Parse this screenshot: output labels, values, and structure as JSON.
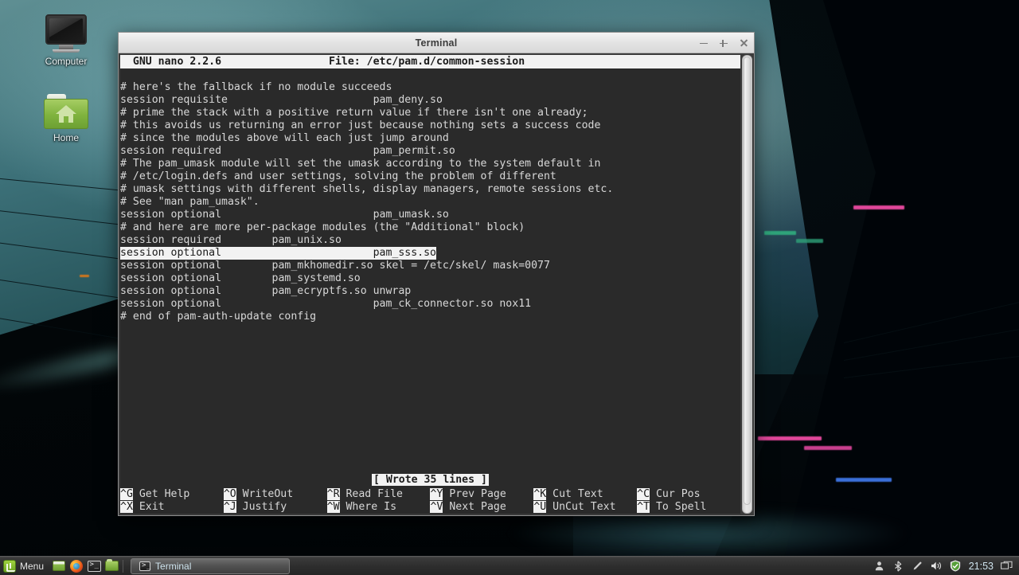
{
  "desktop": {
    "icons": [
      {
        "name": "computer",
        "label": "Computer"
      },
      {
        "name": "home",
        "label": "Home"
      }
    ],
    "wallpaper_colors": {
      "sky_light": "#5f8f93",
      "sky_mid": "#255258",
      "sky_dark": "#0c2429",
      "building": "#02080b",
      "neon_pink": "#e0479a",
      "neon_blue": "#3a6fd8",
      "neon_green": "#2fa37a"
    }
  },
  "window": {
    "title": "Terminal",
    "controls": {
      "minimize": "minimize",
      "maximize": "maximize",
      "close": "close"
    }
  },
  "nano": {
    "header_left": "  GNU nano 2.2.6",
    "header_file": "File: /etc/pam.d/common-session",
    "header_full": "  GNU nano 2.2.6                 File: /etc/pam.d/common-session",
    "status_message": "[ Wrote 35 lines ]",
    "selected_line_index": 13,
    "lines": [
      "# here's the fallback if no module succeeds",
      "session requisite                       pam_deny.so",
      "# prime the stack with a positive return value if there isn't one already;",
      "# this avoids us returning an error just because nothing sets a success code",
      "# since the modules above will each just jump around",
      "session required                        pam_permit.so",
      "# The pam_umask module will set the umask according to the system default in",
      "# /etc/login.defs and user settings, solving the problem of different",
      "# umask settings with different shells, display managers, remote sessions etc.",
      "# See \"man pam_umask\".",
      "session optional                        pam_umask.so",
      "# and here are more per-package modules (the \"Additional\" block)",
      "session required        pam_unix.so",
      "session optional                        pam_sss.so",
      "session optional        pam_mkhomedir.so skel = /etc/skel/ mask=0077",
      "session optional        pam_systemd.so",
      "session optional        pam_ecryptfs.so unwrap",
      "session optional                        pam_ck_connector.so nox11",
      "# end of pam-auth-update config"
    ],
    "shortcuts_row1": [
      {
        "key": "^G",
        "label": " Get Help"
      },
      {
        "key": "^O",
        "label": " WriteOut"
      },
      {
        "key": "^R",
        "label": " Read File"
      },
      {
        "key": "^Y",
        "label": " Prev Page"
      },
      {
        "key": "^K",
        "label": " Cut Text"
      },
      {
        "key": "^C",
        "label": " Cur Pos"
      }
    ],
    "shortcuts_row2": [
      {
        "key": "^X",
        "label": " Exit"
      },
      {
        "key": "^J",
        "label": " Justify"
      },
      {
        "key": "^W",
        "label": " Where Is"
      },
      {
        "key": "^V",
        "label": " Next Page"
      },
      {
        "key": "^U",
        "label": " UnCut Text"
      },
      {
        "key": "^T",
        "label": " To Spell"
      }
    ]
  },
  "taskbar": {
    "menu_label": "Menu",
    "launchers": [
      {
        "name": "show-desktop",
        "title": "Show Desktop"
      },
      {
        "name": "firefox",
        "title": "Firefox Web Browser"
      },
      {
        "name": "terminal",
        "title": "Terminal"
      },
      {
        "name": "files",
        "title": "Files"
      }
    ],
    "windows": [
      {
        "name": "terminal",
        "label": "Terminal",
        "active": true
      }
    ],
    "tray": [
      "user-icon",
      "bluetooth-icon",
      "pen-icon",
      "volume-icon",
      "shield-update-icon"
    ],
    "clock": "21:53",
    "workspace_icon": "window-list-icon"
  }
}
